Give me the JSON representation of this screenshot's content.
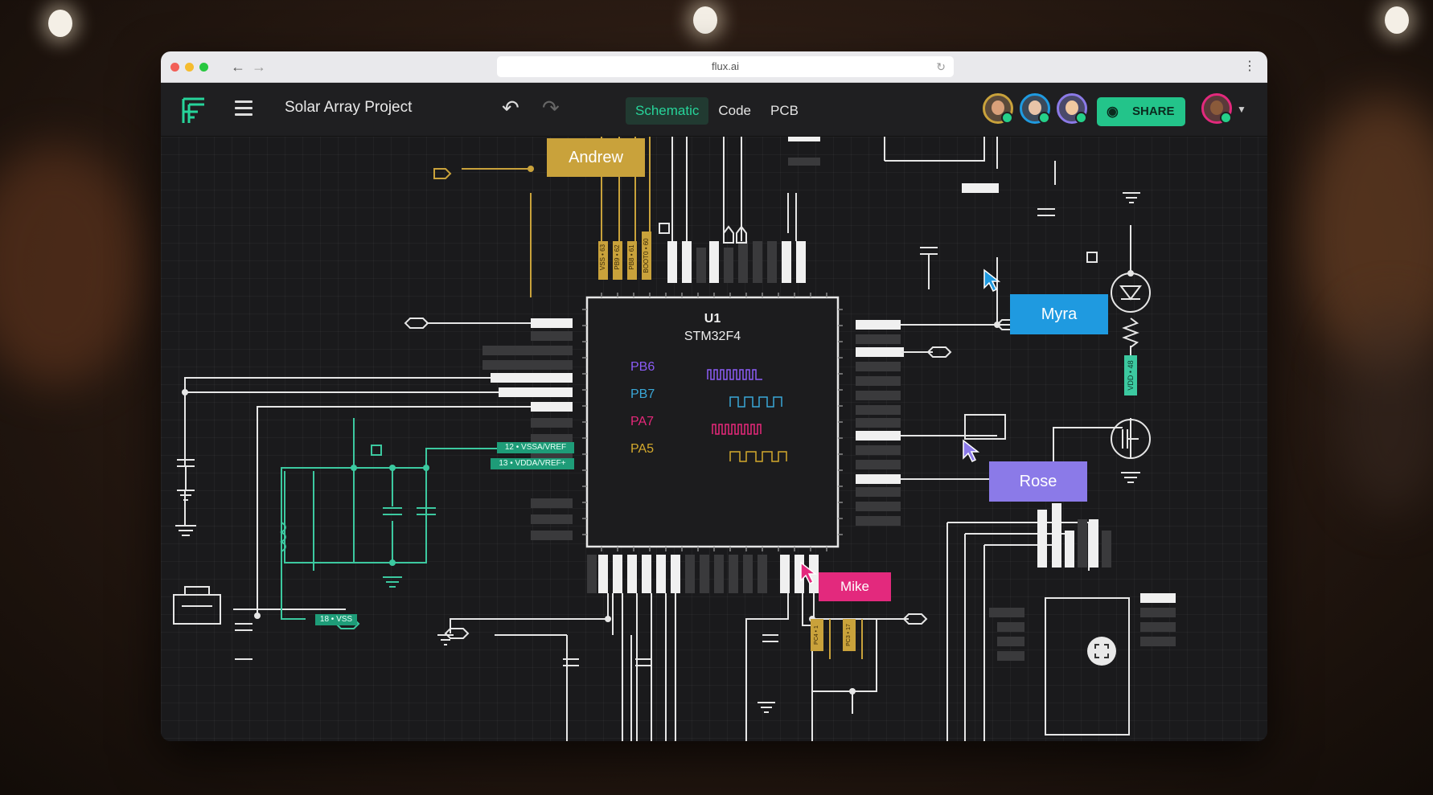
{
  "browser": {
    "url": "flux.ai"
  },
  "app": {
    "project_title": "Solar Array Project",
    "tabs": [
      {
        "label": "Schematic",
        "active": true
      },
      {
        "label": "Code",
        "active": false
      },
      {
        "label": "PCB",
        "active": false
      }
    ],
    "share_label": "SHARE",
    "colors": {
      "accent": "#23c48a",
      "canvas": "#1a1a1c",
      "toolbar": "#1f1f21"
    }
  },
  "schematic": {
    "chip": {
      "ref": "U1",
      "part": "STM32F4",
      "signals": [
        {
          "name": "PB6",
          "color": "#8b5cf6"
        },
        {
          "name": "PB7",
          "color": "#3aa8d8"
        },
        {
          "name": "PA7",
          "color": "#e6287a"
        },
        {
          "name": "PA5",
          "color": "#d4a92d"
        }
      ]
    },
    "net_labels": {
      "vss_63": "VSS • 63",
      "pb9_62": "PB9 • 62",
      "pb8_61": "PB8 • 61",
      "boot0_60": "BOOT0 • 60",
      "vssa_vref": "12 • VSSA/VREF",
      "vdda_vref": "13 • VDDA/VREF+",
      "vss_18": "18 • VSS",
      "vdd_48": "VDD • 48",
      "pc4": "PC4 • 1",
      "pc3": "PC3 • 17"
    }
  },
  "collaborators": [
    {
      "name": "Andrew",
      "color": "#c9a23b"
    },
    {
      "name": "Myra",
      "color": "#1f9ae0"
    },
    {
      "name": "Rose",
      "color": "#8b7ae8"
    },
    {
      "name": "Mike",
      "color": "#e3297d"
    }
  ]
}
